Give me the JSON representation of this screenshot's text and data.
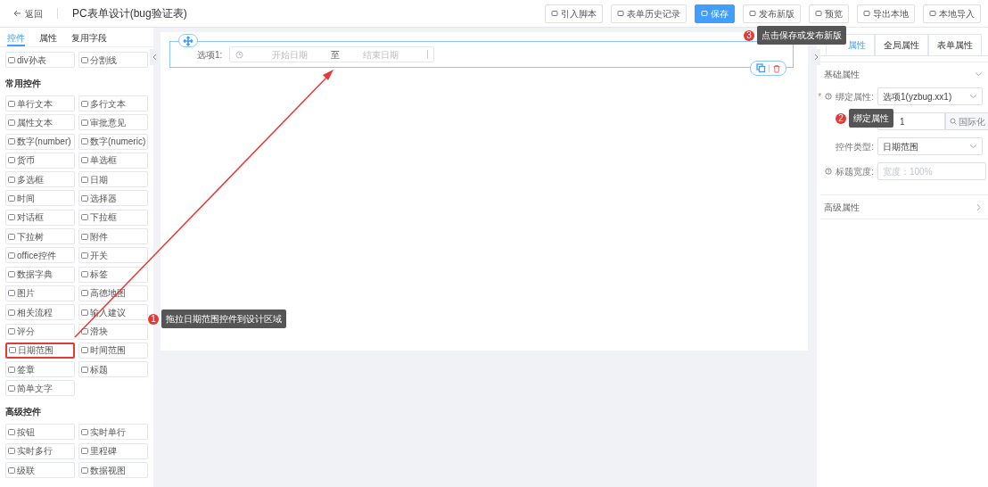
{
  "header": {
    "back": "返回",
    "title": "PC表单设计(bug验证表)",
    "buttons": [
      {
        "label": "引入脚本",
        "kind": "default"
      },
      {
        "label": "表单历史记录",
        "kind": "default"
      },
      {
        "label": "保存",
        "kind": "primary"
      },
      {
        "label": "发布新版",
        "kind": "default"
      },
      {
        "label": "预览",
        "kind": "default"
      },
      {
        "label": "导出本地",
        "kind": "default"
      },
      {
        "label": "本地导入",
        "kind": "default"
      }
    ]
  },
  "left_panel": {
    "tabs": [
      {
        "label": "控件",
        "selected": true
      },
      {
        "label": "属性",
        "selected": false
      },
      {
        "label": "复用字段",
        "selected": false
      }
    ],
    "groups": [
      {
        "items": [
          {
            "label": "div孙表",
            "highlighted": false
          },
          {
            "label": "分割线",
            "highlighted": false
          }
        ]
      },
      {
        "heading": "常用控件",
        "items": [
          {
            "label": "单行文本",
            "highlighted": false
          },
          {
            "label": "多行文本",
            "highlighted": false
          },
          {
            "label": "属性文本",
            "highlighted": false
          },
          {
            "label": "审批意见",
            "highlighted": false
          },
          {
            "label": "数字(number)",
            "highlighted": false
          },
          {
            "label": "数字(numeric)",
            "highlighted": false
          },
          {
            "label": "货币",
            "highlighted": false
          },
          {
            "label": "单选框",
            "highlighted": false
          },
          {
            "label": "多选框",
            "highlighted": false
          },
          {
            "label": "日期",
            "highlighted": false
          },
          {
            "label": "时间",
            "highlighted": false
          },
          {
            "label": "选择器",
            "highlighted": false
          },
          {
            "label": "对话框",
            "highlighted": false
          },
          {
            "label": "下拉框",
            "highlighted": false
          },
          {
            "label": "下拉树",
            "highlighted": false
          },
          {
            "label": "附件",
            "highlighted": false
          },
          {
            "label": "office控件",
            "highlighted": false
          },
          {
            "label": "开关",
            "highlighted": false
          },
          {
            "label": "数据字典",
            "highlighted": false
          },
          {
            "label": "标签",
            "highlighted": false
          },
          {
            "label": "图片",
            "highlighted": false
          },
          {
            "label": "高德地图",
            "highlighted": false
          },
          {
            "label": "相关流程",
            "highlighted": false
          },
          {
            "label": "输入建议",
            "highlighted": false
          },
          {
            "label": "评分",
            "highlighted": false
          },
          {
            "label": "滑块",
            "highlighted": false
          },
          {
            "label": "日期范围",
            "highlighted": true
          },
          {
            "label": "时间范围",
            "highlighted": false
          },
          {
            "label": "签章",
            "highlighted": false
          },
          {
            "label": "标题",
            "highlighted": false
          },
          {
            "label": "简单文字",
            "highlighted": false
          }
        ]
      },
      {
        "heading": "高级控件",
        "items": [
          {
            "label": "按钮",
            "highlighted": false
          },
          {
            "label": "实时单行",
            "highlighted": false
          },
          {
            "label": "实时多行",
            "highlighted": false
          },
          {
            "label": "里程碑",
            "highlighted": false
          },
          {
            "label": "级联",
            "highlighted": false
          },
          {
            "label": "数据视图",
            "highlighted": false
          }
        ]
      }
    ]
  },
  "canvas": {
    "field": {
      "label": "选项1:",
      "start_placeholder": "开始日期",
      "separator": "至",
      "end_placeholder": "结束日期",
      "selected": true
    }
  },
  "right_panel": {
    "tabs": [
      {
        "label": "属性",
        "selected": true
      },
      {
        "label": "全局属性",
        "selected": false
      },
      {
        "label": "表单属性",
        "selected": false
      }
    ],
    "sections": [
      {
        "title": "基础属性",
        "expanded": true,
        "fields": [
          {
            "kind": "select",
            "marker": "*",
            "label": "绑定属性:",
            "help": true,
            "value": "选项1(yzbug.xx1)"
          },
          {
            "kind": "input-button",
            "value": "1",
            "button": "国际化"
          },
          {
            "kind": "select",
            "label": "控件类型:",
            "help": false,
            "value": "日期范围"
          },
          {
            "kind": "input",
            "label": "标题宽度:",
            "help": true,
            "placeholder": "宽度：100%"
          }
        ]
      },
      {
        "title": "高级属性",
        "expanded": false
      }
    ]
  },
  "annotations": [
    {
      "number": "1",
      "text": "拖拉日期范围控件到设计区域"
    },
    {
      "number": "2",
      "text": "绑定属性"
    },
    {
      "number": "3",
      "text": "点击保存或发布新版"
    }
  ]
}
